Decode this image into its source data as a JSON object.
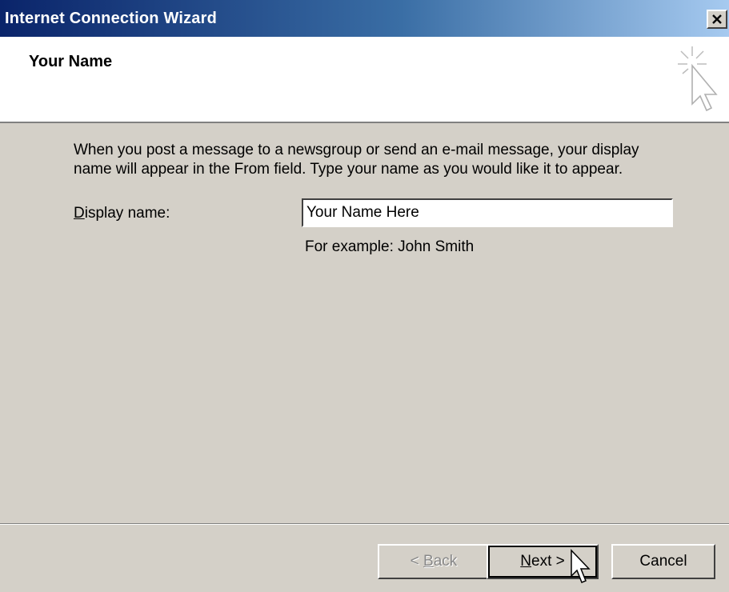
{
  "window": {
    "title": "Internet Connection Wizard",
    "close_label": "×"
  },
  "header": {
    "title": "Your Name",
    "icon": "wizard-cursor-sparkle-icon"
  },
  "body": {
    "description_line1": "When you post a message to a newsgroup or send an e-mail message, your display",
    "description_line2": "name will appear in the From field.  Type your name as you would like it to appear.",
    "field_label_accel": "D",
    "field_label_rest": "isplay name:",
    "field_value": "Your Name Here",
    "example": "For example: John Smith"
  },
  "buttons": {
    "back_prefix": "< ",
    "back_accel": "B",
    "back_rest": "ack",
    "next_accel": "N",
    "next_rest": "ext >",
    "cancel": "Cancel"
  },
  "colors": {
    "titlebar_start": "#0a246a",
    "titlebar_end": "#a6caf0",
    "face": "#d4d0c8"
  }
}
